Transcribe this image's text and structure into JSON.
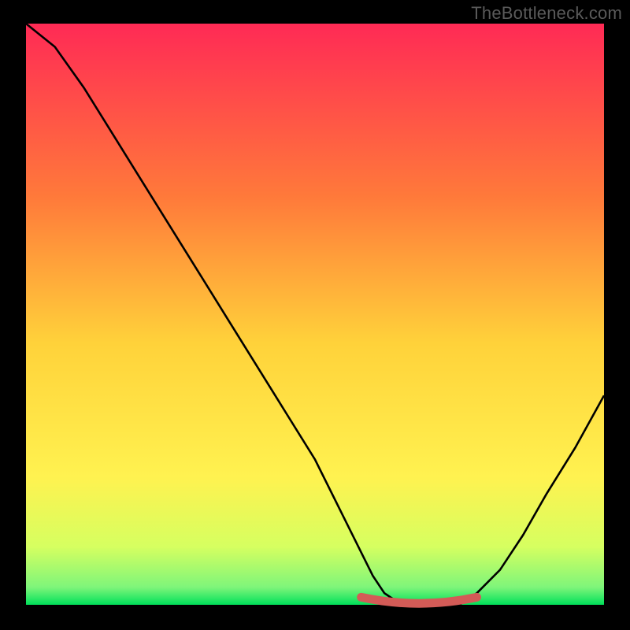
{
  "watermark": "TheBottleneck.com",
  "chart_data": {
    "type": "line",
    "title": "",
    "xlabel": "",
    "ylabel": "",
    "xlim": [
      0,
      100
    ],
    "ylim": [
      0,
      100
    ],
    "grid": false,
    "legend": false,
    "background_gradient": {
      "top": "#ff2a55",
      "mid_upper": "#ff7a3a",
      "mid": "#ffd23a",
      "mid_lower": "#fff250",
      "near_bottom": "#d6ff60",
      "bottom": "#00e05a"
    },
    "curve": {
      "description": "deviation curve from top-left falling to a flat minimum around x≈62–75 then rising to right edge",
      "x": [
        0,
        5,
        10,
        15,
        20,
        25,
        30,
        35,
        40,
        45,
        50,
        55,
        58,
        60,
        62,
        65,
        68,
        72,
        75,
        78,
        82,
        86,
        90,
        95,
        100
      ],
      "y": [
        100,
        96,
        89,
        81,
        73,
        65,
        57,
        49,
        41,
        33,
        25,
        15,
        9,
        5,
        2,
        0,
        0,
        0,
        0,
        2,
        6,
        12,
        19,
        27,
        36
      ]
    },
    "highlight_segment": {
      "description": "shallow curved bar on the baseline marking the optimal range",
      "x_start": 58,
      "x_end": 78,
      "color": "#d35b57"
    }
  }
}
